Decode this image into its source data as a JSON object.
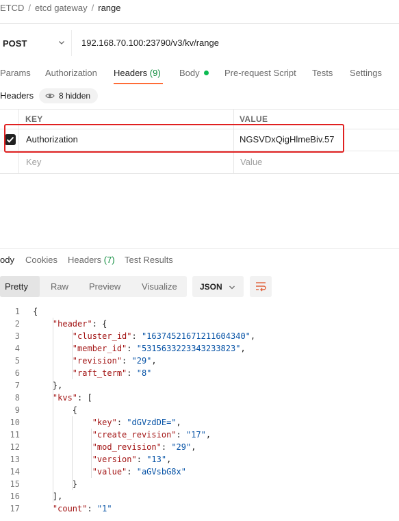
{
  "breadcrumb": [
    "ETCD",
    "etcd gateway",
    "range"
  ],
  "request": {
    "method": "POST",
    "url": "192.168.70.100:23790/v3/kv/range"
  },
  "request_tabs": [
    {
      "label": "Params"
    },
    {
      "label": "Authorization"
    },
    {
      "label": "Headers",
      "count": "(9)"
    },
    {
      "label": "Body"
    },
    {
      "label": "Pre-request Script"
    },
    {
      "label": "Tests"
    },
    {
      "label": "Settings"
    }
  ],
  "headers_section": {
    "title": "Headers",
    "hidden_label": "8 hidden"
  },
  "headers_table": {
    "columns": [
      "KEY",
      "VALUE"
    ],
    "rows": [
      {
        "checked": true,
        "key": "Authorization",
        "value": "NGSVDxQigHlmeBiv.57"
      }
    ],
    "placeholder_key": "Key",
    "placeholder_value": "Value"
  },
  "response_tabs": [
    {
      "label": "ody"
    },
    {
      "label": "Cookies"
    },
    {
      "label": "Headers",
      "count": "(7)"
    },
    {
      "label": "Test Results"
    }
  ],
  "view_modes": [
    "Pretty",
    "Raw",
    "Preview",
    "Visualize"
  ],
  "format": "JSON",
  "colors": {
    "accent": "#ff6c37",
    "highlight_box": "#e02020",
    "count_green": "#0a8a3a",
    "json_key": "#a31515",
    "json_string": "#0451a5"
  },
  "icons": [
    "chevron-down-icon",
    "eye-icon",
    "check-icon",
    "wrap-lines-icon"
  ],
  "response_body_lines": [
    {
      "n": "1",
      "text": "{"
    },
    {
      "n": "2",
      "text": "    \"header\": {"
    },
    {
      "n": "3",
      "text": "        \"cluster_id\": \"16374521671211604340\","
    },
    {
      "n": "4",
      "text": "        \"member_id\": \"5315633223343233823\","
    },
    {
      "n": "5",
      "text": "        \"revision\": \"29\","
    },
    {
      "n": "6",
      "text": "        \"raft_term\": \"8\""
    },
    {
      "n": "7",
      "text": "    },"
    },
    {
      "n": "8",
      "text": "    \"kvs\": ["
    },
    {
      "n": "9",
      "text": "        {"
    },
    {
      "n": "10",
      "text": "            \"key\": \"dGVzdDE=\","
    },
    {
      "n": "11",
      "text": "            \"create_revision\": \"17\","
    },
    {
      "n": "12",
      "text": "            \"mod_revision\": \"29\","
    },
    {
      "n": "13",
      "text": "            \"version\": \"13\","
    },
    {
      "n": "14",
      "text": "            \"value\": \"aGVsbG8x\""
    },
    {
      "n": "15",
      "text": "        }"
    },
    {
      "n": "16",
      "text": "    ],"
    },
    {
      "n": "17",
      "text": "    \"count\": \"1\""
    }
  ]
}
